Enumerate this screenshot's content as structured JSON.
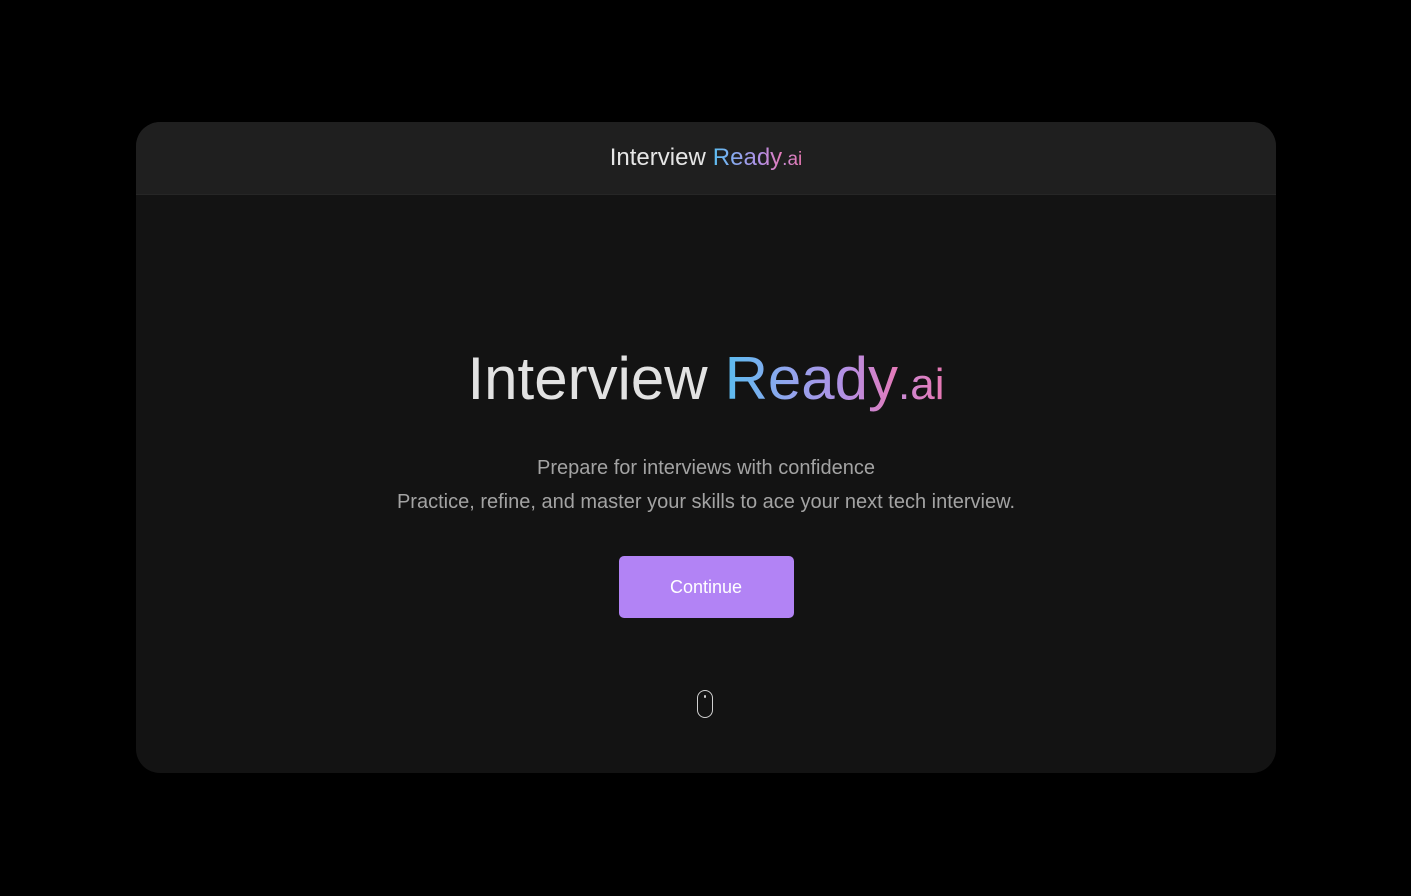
{
  "header": {
    "brand": {
      "word1": "Interview",
      "word2": "Ready",
      "suffix": ".ai"
    }
  },
  "hero": {
    "title": {
      "word1": "Interview",
      "word2": "Ready",
      "suffix": ".ai"
    },
    "tagline_line1": "Prepare for interviews with confidence",
    "tagline_line2": "Practice, refine, and master your skills to ace your next tech interview.",
    "continue_label": "Continue"
  },
  "icons": {
    "scroll_indicator": "mouse-scroll-icon"
  },
  "colors": {
    "page_background": "#000000",
    "card_background": "#131313",
    "header_background": "#1f1f1f",
    "accent_button": "#b283f5",
    "gradient_start": "#5bbdf0",
    "gradient_end": "#e57ab8"
  }
}
